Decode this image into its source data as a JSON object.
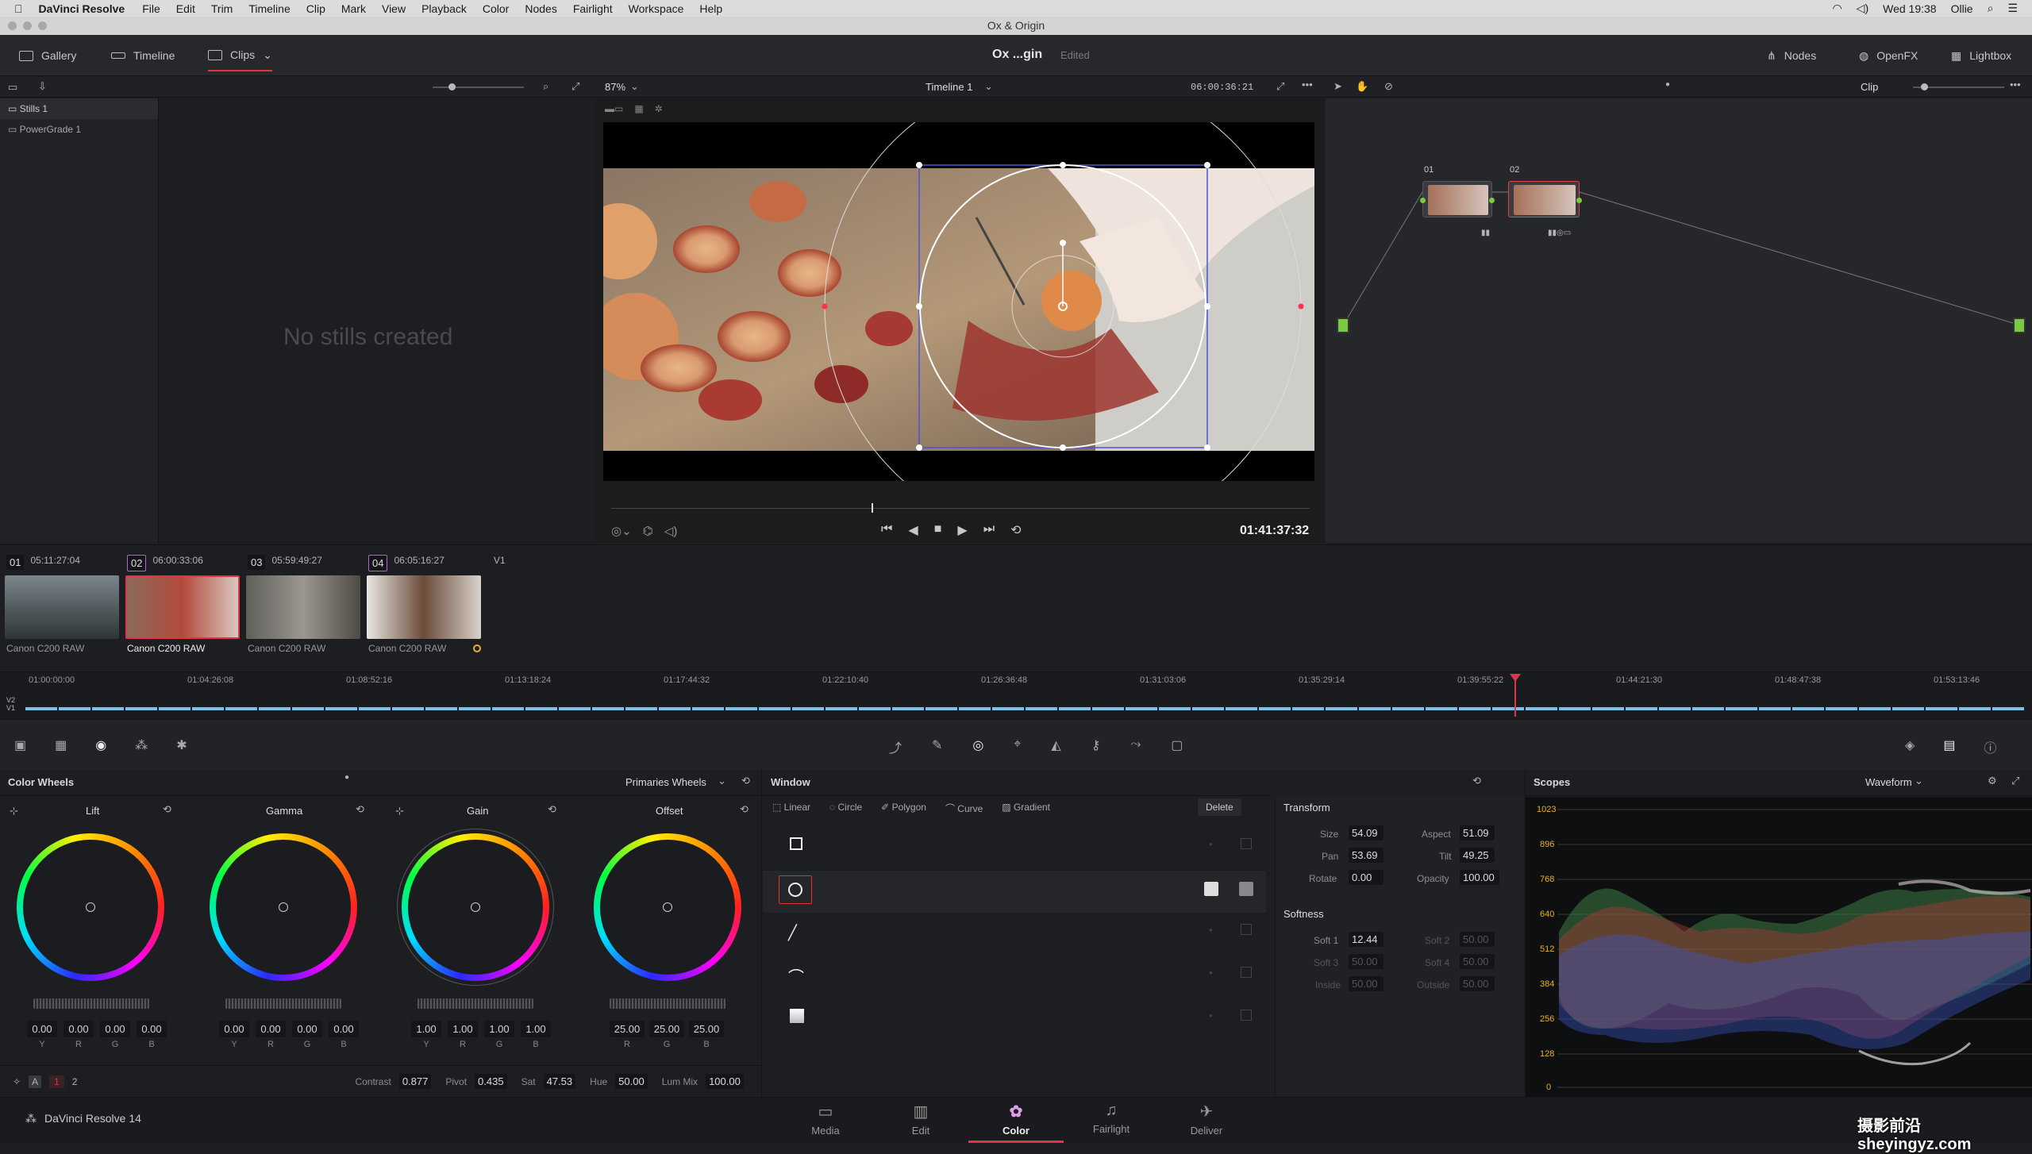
{
  "menubar": {
    "apple": "",
    "app": "DaVinci Resolve",
    "items": [
      "File",
      "Edit",
      "Trim",
      "Timeline",
      "Clip",
      "Mark",
      "View",
      "Playback",
      "Color",
      "Nodes",
      "Fairlight",
      "Workspace",
      "Help"
    ],
    "clock": "Wed 19:38",
    "user": "Ollie"
  },
  "window_title": "Ox & Origin",
  "header": {
    "gallery": "Gallery",
    "timeline": "Timeline",
    "clips": "Clips",
    "project": "Ox ...gin",
    "edited": "Edited",
    "nodes": "Nodes",
    "openfx": "OpenFX",
    "lightbox": "Lightbox"
  },
  "viewer": {
    "zoom": "87%",
    "timeline_name": "Timeline 1",
    "timecode": "06:00:36:21",
    "mode": "Clip",
    "playhead": "01:41:37:32"
  },
  "gallery": {
    "stills": "Stills 1",
    "powergrade": "PowerGrade 1",
    "empty": "No stills created"
  },
  "nodes": [
    {
      "id": "01"
    },
    {
      "id": "02"
    }
  ],
  "clips": [
    {
      "num": "01",
      "tc": "05:11:27:04",
      "track": "V1",
      "name": "Canon C200 RAW"
    },
    {
      "num": "02",
      "tc": "06:00:33:06",
      "track": "V1",
      "name": "Canon C200 RAW"
    },
    {
      "num": "03",
      "tc": "05:59:49:27",
      "track": "V1",
      "name": "Canon C200 RAW"
    },
    {
      "num": "04",
      "tc": "06:05:16:27",
      "track": "V1",
      "name": "Canon C200 RAW"
    }
  ],
  "ruler": [
    "01:00:00:00",
    "01:04:26:08",
    "01:08:52:16",
    "01:13:18:24",
    "01:17:44:32",
    "01:22:10:40",
    "01:26:36:48",
    "01:31:03:06",
    "01:35:29:14",
    "01:39:55:22",
    "01:44:21:30",
    "01:48:47:38",
    "01:53:13:46"
  ],
  "tracks": [
    "V2",
    "V1"
  ],
  "color_wheels": {
    "title": "Color Wheels",
    "mode": "Primaries Wheels",
    "wheels": [
      {
        "name": "Lift",
        "values": [
          "0.00",
          "0.00",
          "0.00",
          "0.00"
        ],
        "channels": [
          "Y",
          "R",
          "G",
          "B"
        ]
      },
      {
        "name": "Gamma",
        "values": [
          "0.00",
          "0.00",
          "0.00",
          "0.00"
        ],
        "channels": [
          "Y",
          "R",
          "G",
          "B"
        ]
      },
      {
        "name": "Gain",
        "values": [
          "1.00",
          "1.00",
          "1.00",
          "1.00"
        ],
        "channels": [
          "Y",
          "R",
          "G",
          "B"
        ]
      },
      {
        "name": "Offset",
        "values": [
          "25.00",
          "25.00",
          "25.00"
        ],
        "channels": [
          "R",
          "G",
          "B"
        ]
      }
    ],
    "footer": {
      "page1": "1",
      "page2": "2",
      "contrast_label": "Contrast",
      "contrast": "0.877",
      "pivot_label": "Pivot",
      "pivot": "0.435",
      "sat_label": "Sat",
      "sat": "47.53",
      "hue_label": "Hue",
      "hue": "50.00",
      "lummix_label": "Lum Mix",
      "lummix": "100.00"
    }
  },
  "window": {
    "title": "Window",
    "tools": [
      "Linear",
      "Circle",
      "Polygon",
      "Curve",
      "Gradient"
    ],
    "delete": "Delete"
  },
  "transform": {
    "title": "Transform",
    "size_label": "Size",
    "size": "54.09",
    "aspect_label": "Aspect",
    "aspect": "51.09",
    "pan_label": "Pan",
    "pan": "53.69",
    "tilt_label": "Tilt",
    "tilt": "49.25",
    "rotate_label": "Rotate",
    "rotate": "0.00",
    "opacity_label": "Opacity",
    "opacity": "100.00",
    "softness_title": "Softness",
    "soft1_label": "Soft 1",
    "soft1": "12.44",
    "soft2_label": "Soft 2",
    "soft2": "50.00",
    "soft3_label": "Soft 3",
    "soft3": "50.00",
    "soft4_label": "Soft 4",
    "soft4": "50.00",
    "inside_label": "Inside",
    "inside": "50.00",
    "outside_label": "Outside",
    "outside": "50.00"
  },
  "scopes": {
    "title": "Scopes",
    "mode": "Waveform",
    "ticks": [
      "1023",
      "896",
      "768",
      "640",
      "512",
      "384",
      "256",
      "128",
      "0"
    ]
  },
  "pages": [
    "Media",
    "Edit",
    "Color",
    "Fairlight",
    "Deliver"
  ],
  "active_page": "Color",
  "brand": "DaVinci Resolve 14",
  "watermark": "摄影前沿 sheyingyz.com"
}
